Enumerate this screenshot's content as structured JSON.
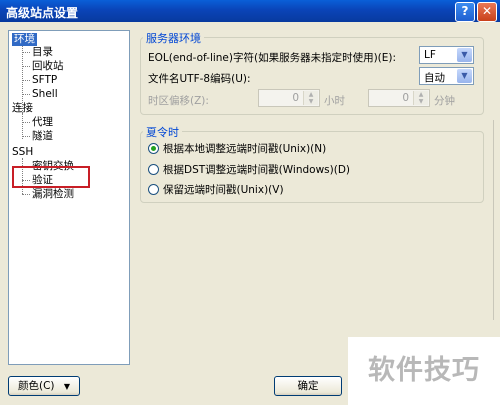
{
  "window": {
    "title": "高级站点设置"
  },
  "titlebar": {
    "help_glyph": "?",
    "close_glyph": "✕"
  },
  "tree": {
    "items": [
      {
        "label": "环境",
        "selected": true
      },
      {
        "label": "目录"
      },
      {
        "label": "回收站"
      },
      {
        "label": "SFTP"
      },
      {
        "label": "Shell"
      },
      {
        "label": "连接"
      },
      {
        "label": "代理"
      },
      {
        "label": "隧道"
      },
      {
        "label": "SSH"
      },
      {
        "label": "密钥交换"
      },
      {
        "label": "验证"
      },
      {
        "label": "漏洞检测"
      }
    ]
  },
  "server_env": {
    "label": "服务器环境",
    "eol_label": "EOL(end-of-line)字符(如果服务器未指定时使用)(E):",
    "eol_value": "LF",
    "utf8_label": "文件名UTF-8编码(U):",
    "utf8_value": "自动",
    "tz_label": "时区偏移(Z):",
    "hours_value": "0",
    "hours_unit": "小时",
    "minutes_value": "0",
    "minutes_unit": "分钟"
  },
  "dst": {
    "label": "夏令时",
    "options": [
      {
        "label": "根据本地调整远端时间戳(Unix)(N)",
        "checked": true
      },
      {
        "label": "根据DST调整远端时间戳(Windows)(D)",
        "checked": false
      },
      {
        "label": "保留远端时间戳(Unix)(V)",
        "checked": false
      }
    ]
  },
  "footer": {
    "color_button": "颜色(C)",
    "color_arrow": "▼",
    "ok_button": "确定"
  },
  "watermark": {
    "text": "软件技巧"
  }
}
